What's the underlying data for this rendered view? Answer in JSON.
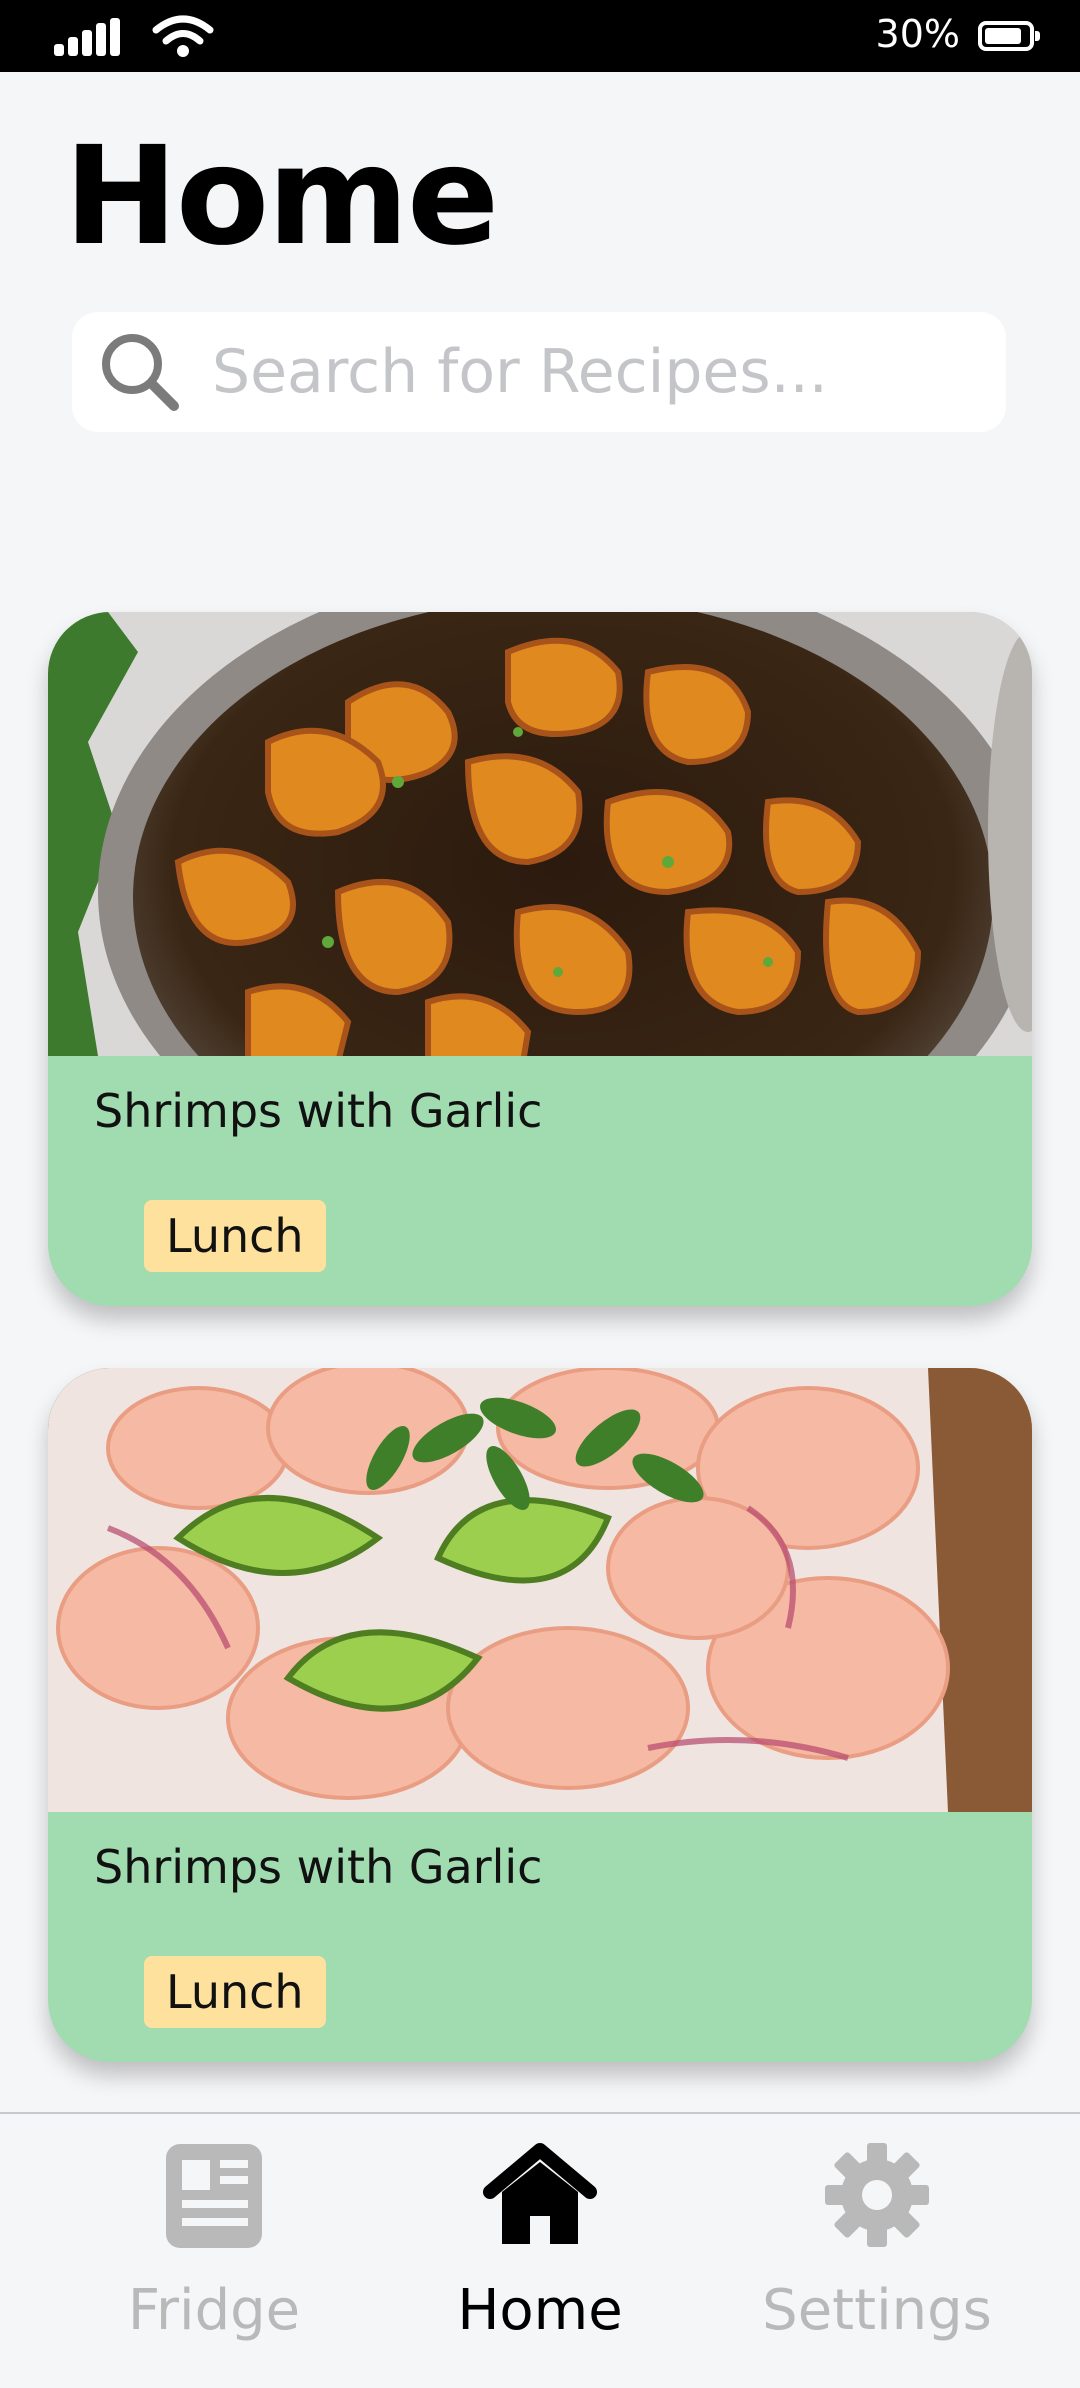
{
  "status_bar": {
    "battery_percent": "30%",
    "icons": [
      "signal-icon",
      "wifi-icon",
      "battery-icon"
    ]
  },
  "page": {
    "title": "Home"
  },
  "search": {
    "placeholder": "Search for Recipes...",
    "value": "",
    "icon": "search-icon"
  },
  "recipes": [
    {
      "title": "Shrimps with Garlic",
      "tag": "Lunch",
      "image": "glazed-shrimp-pan-photo"
    },
    {
      "title": "Shrimps with Garlic",
      "tag": "Lunch",
      "image": "shrimp-ceviche-lime-photo"
    }
  ],
  "nav": {
    "items": [
      {
        "label": "Fridge",
        "icon": "fridge-icon",
        "active": false
      },
      {
        "label": "Home",
        "icon": "home-icon",
        "active": true
      },
      {
        "label": "Settings",
        "icon": "gear-icon",
        "active": false
      }
    ]
  },
  "colors": {
    "background": "#f5f6f8",
    "card": "#a1dbb0",
    "tag": "#fde19d",
    "nav_inactive": "#b9b9b9",
    "nav_active": "#000000"
  }
}
